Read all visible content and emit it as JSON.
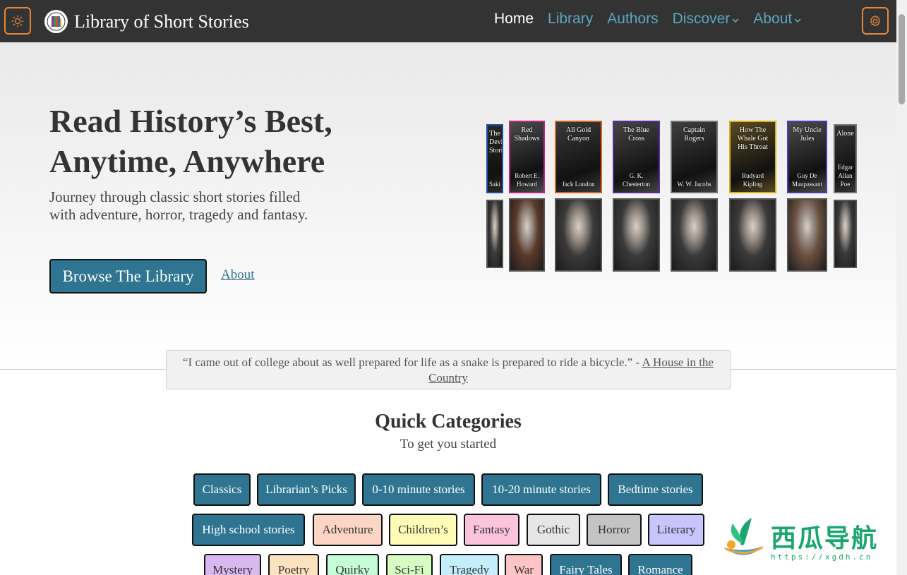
{
  "nav": {
    "brand": "Library of Short Stories",
    "links": [
      {
        "label": "Home",
        "caret": ""
      },
      {
        "label": "Library",
        "caret": ""
      },
      {
        "label": "Authors",
        "caret": ""
      },
      {
        "label": "Discover",
        "caret": "⌄"
      },
      {
        "label": "About",
        "caret": "⌄"
      }
    ],
    "theme_icon": "sun-icon",
    "settings_icon": "gear-icon"
  },
  "hero": {
    "title": "Read History’s Best, Anytime, Anywhere",
    "subtitle": "Journey through classic short stories filled with adventure, horror, tragedy and fantasy.",
    "browse_label": "Browse The Library",
    "about_label": "About"
  },
  "books": [
    {
      "title": "The Devil's Stories",
      "author": "Saki",
      "color": "#2a2a2a",
      "border": "#1f4fa5"
    },
    {
      "title": "Red Shadows",
      "author": "Robert E. Howard",
      "color": "#4b4b4b",
      "border": "#c0238a"
    },
    {
      "title": "All Gold Canyon",
      "author": "Jack London",
      "color": "#3a3a3a",
      "border": "#d9661f"
    },
    {
      "title": "The Blue Cross",
      "author": "G. K. Chesterton",
      "color": "#454545",
      "border": "#5a2aa0"
    },
    {
      "title": "Captain Rogers",
      "author": "W. W. Jacobs",
      "color": "#3f3f3f",
      "border": "#777777"
    },
    {
      "title": "How The Whale Got His Throat",
      "author": "Rudyard Kipling",
      "color": "#5a4a20",
      "border": "#d4b31c"
    },
    {
      "title": "My Uncle Jules",
      "author": "Guy De Maupassant",
      "color": "#4c4c4c",
      "border": "#4a3cb8"
    },
    {
      "title": "Alone",
      "author": "Edgar Allan Poe",
      "color": "#353535",
      "border": "#777777"
    }
  ],
  "quote": {
    "text": "“I came out of college about as well prepared for life as a snake is prepared to ride a bicycle.” - ",
    "source": "A House in the Country"
  },
  "categories_section": {
    "title": "Quick Categories",
    "subtitle": "To get you started"
  },
  "categories": [
    {
      "label": "Classics",
      "bg": "#2f7591",
      "fg": "#ffffff"
    },
    {
      "label": "Librarian’s Picks",
      "bg": "#2f7591",
      "fg": "#ffffff"
    },
    {
      "label": "0-10 minute stories",
      "bg": "#2f7591",
      "fg": "#ffffff"
    },
    {
      "label": "10-20 minute stories",
      "bg": "#2f7591",
      "fg": "#ffffff"
    },
    {
      "label": "Bedtime stories",
      "bg": "#2f7591",
      "fg": "#ffffff"
    },
    {
      "label": "High school stories",
      "bg": "#2f7591",
      "fg": "#ffffff"
    },
    {
      "label": "Adventure",
      "bg": "#fcd5c4",
      "fg": "#333333"
    },
    {
      "label": "Children’s",
      "bg": "#fffcb8",
      "fg": "#333333"
    },
    {
      "label": "Fantasy",
      "bg": "#fcc4dc",
      "fg": "#333333"
    },
    {
      "label": "Gothic",
      "bg": "#e6e6e6",
      "fg": "#333333"
    },
    {
      "label": "Horror",
      "bg": "#c4c4c4",
      "fg": "#333333"
    },
    {
      "label": "Literary",
      "bg": "#c8c4fc",
      "fg": "#333333"
    },
    {
      "label": "Mystery",
      "bg": "#d9b8f0",
      "fg": "#333333"
    },
    {
      "label": "Poetry",
      "bg": "#fde2c0",
      "fg": "#333333"
    },
    {
      "label": "Quirky",
      "bg": "#c4fcd8",
      "fg": "#333333"
    },
    {
      "label": "Sci-Fi",
      "bg": "#d6fcc4",
      "fg": "#333333"
    },
    {
      "label": "Tragedy",
      "bg": "#c4eefc",
      "fg": "#333333"
    },
    {
      "label": "War",
      "bg": "#fcc4c4",
      "fg": "#333333"
    },
    {
      "label": "Fairy Tales",
      "bg": "#2f7591",
      "fg": "#ffffff"
    },
    {
      "label": "Romance",
      "bg": "#2f7591",
      "fg": "#ffffff"
    }
  ],
  "watermark": {
    "text": "西瓜导航",
    "url": "https://xgdh.cn"
  }
}
